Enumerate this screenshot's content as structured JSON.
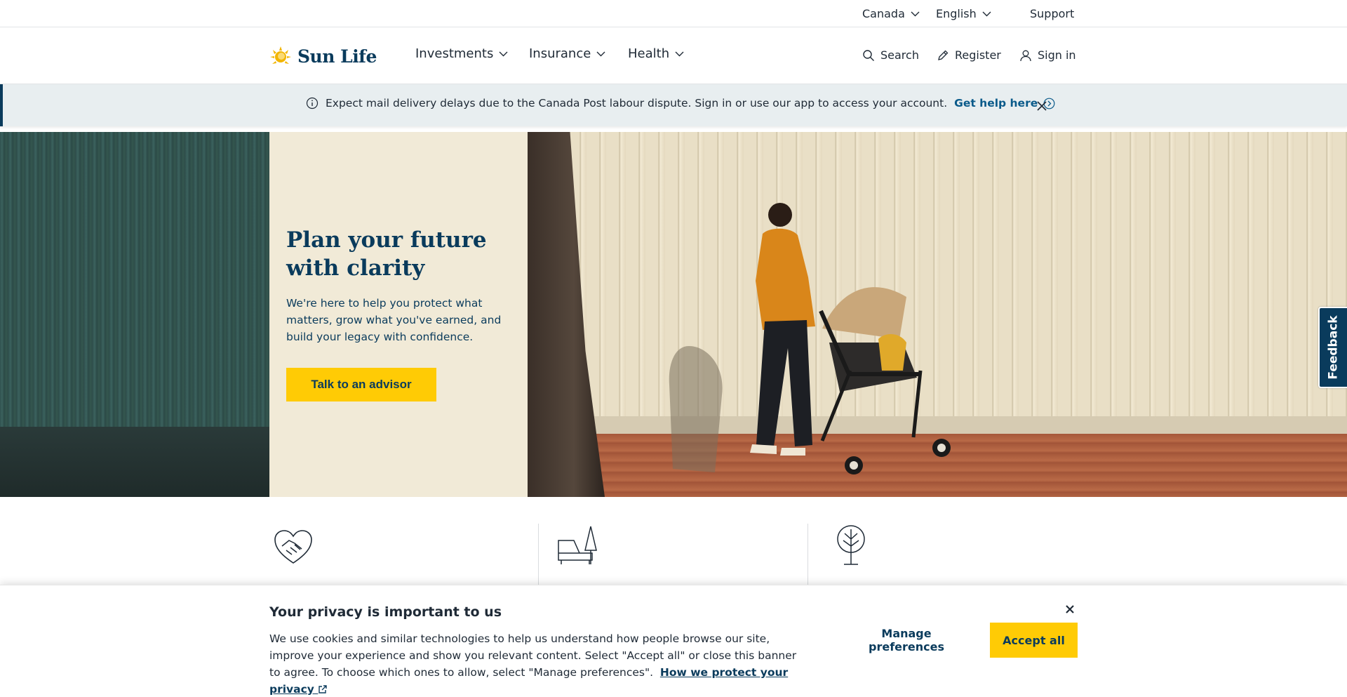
{
  "utility": {
    "country": "Canada",
    "language": "English",
    "support": "Support"
  },
  "header": {
    "logo_text": "Sun Life",
    "nav": [
      "Investments",
      "Insurance",
      "Health"
    ],
    "search": "Search",
    "register": "Register",
    "sign_in": "Sign in"
  },
  "alert": {
    "message": "Expect mail delivery delays due to the Canada Post labour dispute. Sign in or use our app to access your account.",
    "link": "Get help here"
  },
  "hero": {
    "title": "Plan your future with clarity",
    "body": "We're here to help you protect what matters, grow what you've earned, and build your legacy with confidence.",
    "cta": "Talk to an advisor"
  },
  "feedback": "Feedback",
  "cookie": {
    "title": "Your privacy is important to us",
    "body": "We use cookies and similar technologies to help us understand how people browse our site, improve your experience and show you relevant content. Select \"Accept all\" or close this banner to agree. To choose which ones to allow, select \"Manage preferences\".",
    "link": "How we protect your privacy",
    "manage": "Manage preferences",
    "accept": "Accept all"
  },
  "colors": {
    "brand_navy": "#0a3b5c",
    "brand_yellow": "#ffcb05",
    "hero_panel": "#f1ead7"
  }
}
